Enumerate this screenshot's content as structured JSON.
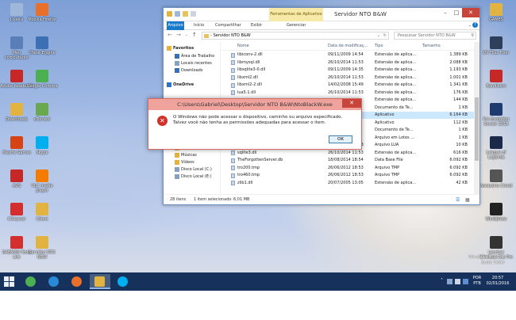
{
  "desktop_icons_left": [
    {
      "label": "Lixeira",
      "color": "#9fb7d8"
    },
    {
      "label": "Mozilla Firefox",
      "color": "#e8702a"
    },
    {
      "label": "Meu computador",
      "color": "#5a7fb8"
    },
    {
      "label": "Cheat Engine",
      "color": "#3d6fb5"
    },
    {
      "label": "Adobe Reader XI",
      "color": "#c62828"
    },
    {
      "label": "Google Chrome",
      "color": "#4caf50"
    },
    {
      "label": "Downloads",
      "color": "#e3b341"
    },
    {
      "label": "uTorrent",
      "color": "#6aa84f"
    },
    {
      "label": "Mestre Games",
      "color": "#d84315"
    },
    {
      "label": "Skype",
      "color": "#00aff0"
    },
    {
      "label": "AVG",
      "color": "#c62828"
    },
    {
      "label": "VLC media player",
      "color": "#f57c00"
    },
    {
      "label": "CCleaner",
      "color": "#d32f2f"
    },
    {
      "label": "Client",
      "color": "#e3b341"
    },
    {
      "label": "DAEMON Tools Lite",
      "color": "#d32f2f"
    },
    {
      "label": "Servidor NTO B&W",
      "color": "#e3b341"
    }
  ],
  "desktop_icons_right": [
    {
      "label": "GAMES",
      "color": "#e3b341"
    },
    {
      "label": "DV Files Fixer",
      "color": "#2e3f5c"
    },
    {
      "label": "Bandicam",
      "color": "#c62828"
    },
    {
      "label": "Pro Evolution Soccer 2015",
      "color": "#1e3a6e"
    },
    {
      "label": "League of Legends",
      "color": "#1b2a4a"
    },
    {
      "label": "Assassins Creed",
      "color": "#555555"
    },
    {
      "label": "WinDjView",
      "color": "#222222"
    },
    {
      "label": "Lanchar Windows 8.1 Pro",
      "color": "#333333"
    }
  ],
  "explorer": {
    "title": "Servidor NTO B&W",
    "context_tab": "Ferramentas de Aplicativo",
    "tabs": [
      "Arquivo",
      "Início",
      "Compartilhar",
      "Exibir"
    ],
    "context_tab_sub": "Gerenciar",
    "address": "Servidor NTO B&W",
    "search_placeholder": "Pesquisar Servidor NTO B&W",
    "columns": [
      "Nome",
      "Data de modificaç...",
      "Tipo",
      "Tamanho"
    ],
    "nav": [
      {
        "label": "Favoritos",
        "color": "#e3b341",
        "bold": true
      },
      {
        "label": "Área de Trabalho",
        "color": "#3d6fb5"
      },
      {
        "label": "Locais recentes",
        "color": "#8aa0bf"
      },
      {
        "label": "Downloads",
        "color": "#3d6fb5"
      },
      {
        "label": "OneDrive",
        "color": "#2f72c4",
        "bold": true
      },
      {
        "label": "Imagens",
        "color": "#e3b341"
      },
      {
        "label": "Músicas",
        "color": "#e3b341"
      },
      {
        "label": "Vídeos",
        "color": "#e3b341"
      },
      {
        "label": "Disco Local (C:)",
        "color": "#8aa0bf"
      },
      {
        "label": "Disco Local (E:)",
        "color": "#8aa0bf"
      }
    ],
    "files": [
      {
        "name": "libiconv-2.dll",
        "date": "09/11/2009 14:54",
        "type": "Extensão de aplica...",
        "size": "1.389 KB"
      },
      {
        "name": "libmysql.dll",
        "date": "26/10/2014 11:53",
        "type": "Extensão de aplica...",
        "size": "2.088 KB"
      },
      {
        "name": "libsqlite3-0.dll",
        "date": "09/11/2009 14:35",
        "type": "Extensão de aplica...",
        "size": "1.193 KB"
      },
      {
        "name": "libxml2.dll",
        "date": "26/10/2014 11:53",
        "type": "Extensão de aplica...",
        "size": "1.001 KB"
      },
      {
        "name": "libxml2-2.dll",
        "date": "14/02/2008 15:49",
        "type": "Extensão de aplica...",
        "size": "1.341 KB"
      },
      {
        "name": "lua5.1.dll",
        "date": "26/10/2014 11:53",
        "type": "Extensão de aplica...",
        "size": "176 KB"
      },
      {
        "name": "",
        "date": "",
        "type": "Extensão de aplica...",
        "size": "144 KB"
      },
      {
        "name": "",
        "date": "",
        "type": "Documento de Te...",
        "size": "1 KB"
      },
      {
        "name": "",
        "date": "",
        "type": "Aplicativo",
        "size": "6.164 KB",
        "selected": true
      },
      {
        "name": "",
        "date": "",
        "type": "Aplicativo",
        "size": "112 KB"
      },
      {
        "name": "",
        "date": "",
        "type": "Documento de Te...",
        "size": "1 KB"
      },
      {
        "name": "",
        "date": "",
        "type": "Arquivo em Lotes ...",
        "size": "1 KB"
      },
      {
        "name": "sql_config.lua",
        "date": "26/10/2014 11:53",
        "type": "Arquivo LUA",
        "size": "10 KB"
      },
      {
        "name": "sqlite3.dll",
        "date": "26/10/2014 11:53",
        "type": "Extensão de aplica...",
        "size": "616 KB"
      },
      {
        "name": "TheForgottenServer.db",
        "date": "18/08/2014 18:54",
        "type": "Data Base File",
        "size": "6.092 KB"
      },
      {
        "name": "tro200.tmp",
        "date": "26/06/2012 18:53",
        "type": "Arquivo TMP",
        "size": "6.092 KB"
      },
      {
        "name": "tro460.tmp",
        "date": "26/06/2012 18:53",
        "type": "Arquivo TMP",
        "size": "6.092 KB"
      },
      {
        "name": "zlib1.dll",
        "date": "20/07/2005 13:05",
        "type": "Extensão de aplica...",
        "size": "42 KB"
      }
    ],
    "status_items": "28 itens",
    "status_selected": "1 item selecionado",
    "status_size": "6,01 MB"
  },
  "dialog": {
    "title": "C:\\Users\\Gabriel\\Desktop\\Servidor NTO B&W\\NtoBlackW.exe",
    "message": "O Windows não pode acessar o dispositivo, caminho ou arquivo especificado. Talvez você não tenha as permissões adequadas para acessar o item.",
    "ok_label": "OK"
  },
  "watermark": {
    "line1": "Windows 8.1 Pro",
    "line2": "Build 9600"
  },
  "taskbar": {
    "apps": [
      {
        "name": "chrome",
        "color": "#4caf50"
      },
      {
        "name": "internet-explorer",
        "color": "#2a8ad8"
      },
      {
        "name": "firefox",
        "color": "#e8702a"
      },
      {
        "name": "file-explorer",
        "color": "#e3b341",
        "active": true
      },
      {
        "name": "skype",
        "color": "#00aff0"
      }
    ],
    "lang": "POR",
    "lang2": "PTB",
    "time": "20:57",
    "date": "02/01/2016"
  }
}
